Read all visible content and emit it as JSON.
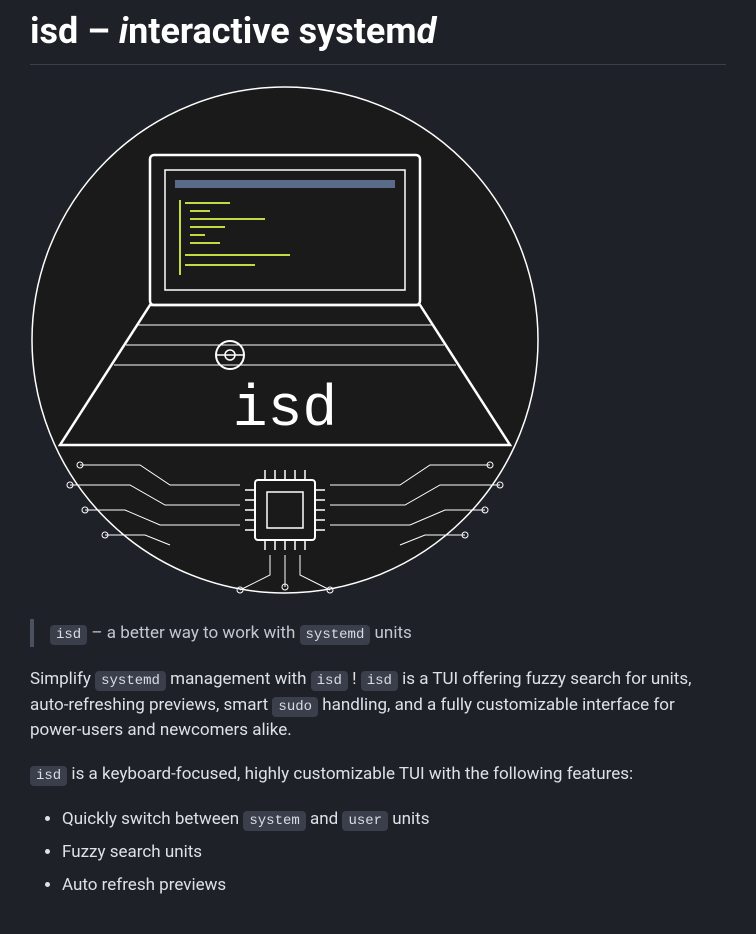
{
  "title": {
    "part1": "isd – ",
    "part2_italic": "i",
    "part3": "nteractive system",
    "part4_italic": "d"
  },
  "blockquote": {
    "code1": "isd",
    "text1": " – a better way to work with ",
    "code2": "systemd",
    "text2": " units"
  },
  "paragraph1": {
    "text1": "Simplify ",
    "code1": "systemd",
    "text2": " management with ",
    "code2": "isd",
    "text3": " ! ",
    "code3": "isd",
    "text4": " is a TUI offering fuzzy search for units, auto-refreshing previews, smart ",
    "code4": "sudo",
    "text5": " handling, and a fully customizable interface for power-users and newcomers alike."
  },
  "paragraph2": {
    "code1": "isd",
    "text1": " is a keyboard-focused, highly customizable TUI with the following features:"
  },
  "features": {
    "item1": {
      "text1": "Quickly switch between ",
      "code1": "system",
      "text2": " and ",
      "code2": "user",
      "text3": " units"
    },
    "item2": "Fuzzy search units",
    "item3": "Auto refresh previews"
  },
  "logo": {
    "text": "isd"
  }
}
